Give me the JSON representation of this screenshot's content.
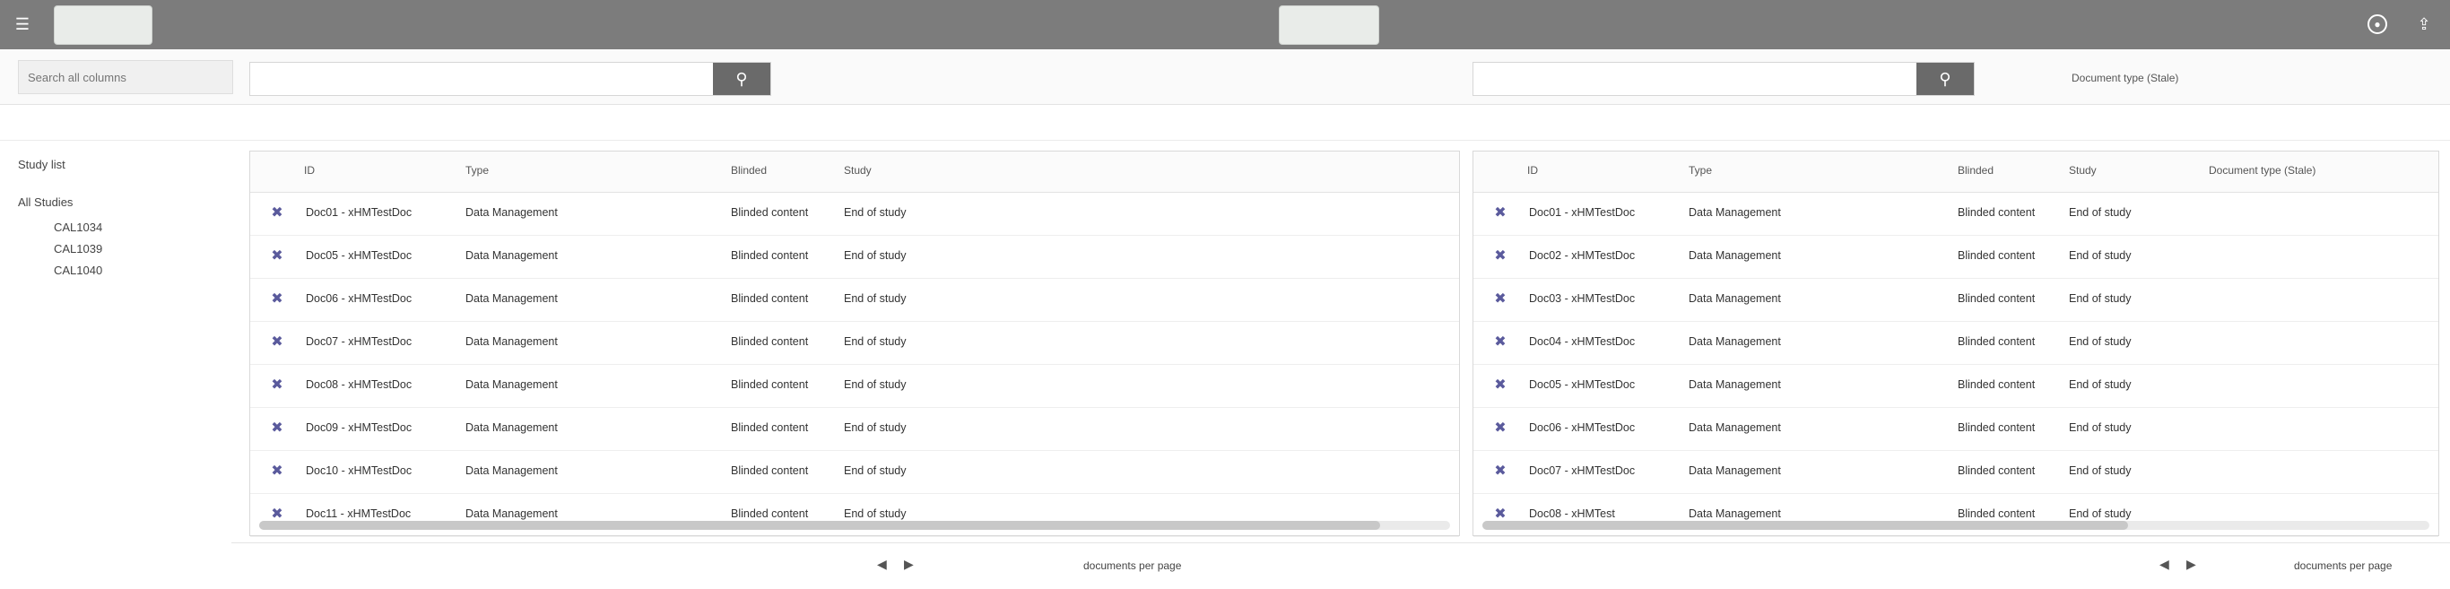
{
  "topbar": {
    "menu_icon": "menu-icon",
    "tab_left_label": "",
    "tab_mid_label": "",
    "user_icon": "user-circle-icon",
    "help_icon": "help-icon"
  },
  "filter": {
    "placeholder": "Search all columns"
  },
  "left_search": {
    "placeholder": ""
  },
  "right_search": {
    "placeholder": ""
  },
  "meta": {
    "left_text": "",
    "right_text": "Document type (Stale)"
  },
  "sidebar": {
    "heading": "Study list",
    "group": "All Studies",
    "items": [
      "CAL1034",
      "CAL1039",
      "CAL1040"
    ]
  },
  "left_table": {
    "headers": [
      "ID",
      "Type",
      "",
      "Blinded",
      "Study"
    ],
    "rows": [
      [
        "Doc01 - xHMTestDoc",
        "Data Management",
        "Blinded content",
        "End of study"
      ],
      [
        "Doc05 - xHMTestDoc",
        "Data Management",
        "Blinded content",
        "End of study"
      ],
      [
        "Doc06 - xHMTestDoc",
        "Data Management",
        "Blinded content",
        "End of study"
      ],
      [
        "Doc07 - xHMTestDoc",
        "Data Management",
        "Blinded content",
        "End of study"
      ],
      [
        "Doc08 - xHMTestDoc",
        "Data Management",
        "Blinded content",
        "End of study"
      ],
      [
        "Doc09 - xHMTestDoc",
        "Data Management",
        "Blinded content",
        "End of study"
      ],
      [
        "Doc10 - xHMTestDoc",
        "Data Management",
        "Blinded content",
        "End of study"
      ],
      [
        "Doc11 - xHMTestDoc",
        "Data Management",
        "Blinded content",
        "End of study"
      ]
    ]
  },
  "right_table": {
    "headers": [
      "ID",
      "Type",
      "Blinded",
      "Study",
      "Document type (Stale)"
    ],
    "rows": [
      [
        "Doc01 - xHMTestDoc",
        "Data Management",
        "Blinded content",
        "End of study"
      ],
      [
        "Doc02 - xHMTestDoc",
        "Data Management",
        "Blinded content",
        "End of study"
      ],
      [
        "Doc03 - xHMTestDoc",
        "Data Management",
        "Blinded content",
        "End of study"
      ],
      [
        "Doc04 - xHMTestDoc",
        "Data Management",
        "Blinded content",
        "End of study"
      ],
      [
        "Doc05 - xHMTestDoc",
        "Data Management",
        "Blinded content",
        "End of study"
      ],
      [
        "Doc06 - xHMTestDoc",
        "Data Management",
        "Blinded content",
        "End of study"
      ],
      [
        "Doc07 - xHMTestDoc",
        "Data Management",
        "Blinded content",
        "End of study"
      ],
      [
        "Doc08 - xHMTest",
        "Data Management",
        "Blinded content",
        "End of study"
      ]
    ]
  },
  "left_footer": {
    "pager_text": "documents per page"
  },
  "right_footer": {
    "pager_text": "documents per page"
  }
}
